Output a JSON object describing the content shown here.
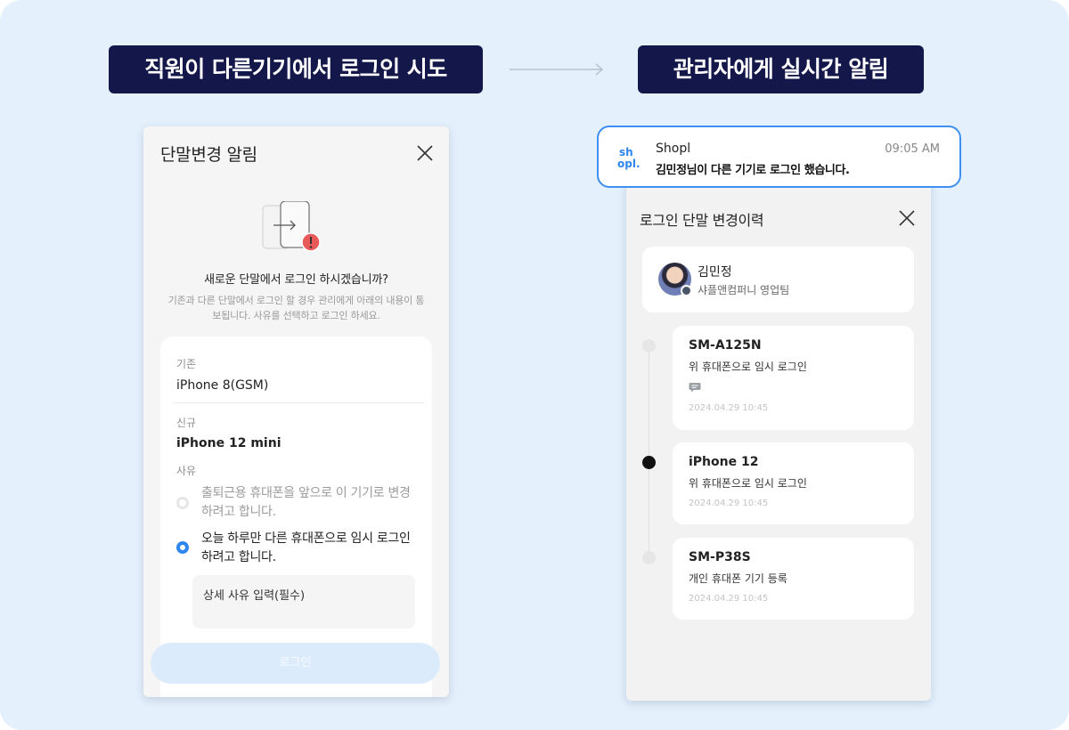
{
  "headline": {
    "left": "직원이 다른기기에서 로그인 시도",
    "right": "관리자에게 실시간 알림"
  },
  "device_change_modal": {
    "title": "단말변경 알림",
    "question": "새로운 단말에서 로그인 하시겠습니까?",
    "description": "기존과 다른 단말에서 로그인 할 경우 관리에게 아래의 내용이 통보됩니다. 사유를 선택하고 로그인 하세요.",
    "existing_label": "기존",
    "existing_value": "iPhone 8(GSM)",
    "new_label": "신규",
    "new_value": "iPhone 12 mini",
    "reason_label": "사유",
    "reason_options": [
      {
        "text": "출퇴근용 휴대폰을 앞으로 이 기기로 변경하려고 합니다.",
        "selected": false
      },
      {
        "text": "오늘 하루만 다른 휴대폰으로 임시 로그인 하려고 합니다.",
        "selected": true
      }
    ],
    "reason_detail_placeholder": "상세 사유 입력(필수)",
    "login_button": "로그인"
  },
  "notification": {
    "app_name": "Shopl",
    "logo_text_top": "sh",
    "logo_text_bottom": "opl.",
    "time": "09:05 AM",
    "message": "김민정님이 다른 기기로 로그인 했습니다."
  },
  "history_modal": {
    "title": "로그인 단말 변경이력",
    "profile": {
      "name": "김민정",
      "team": "샤플앤컴퍼니 영업팀"
    },
    "entries": [
      {
        "model": "SM-A125N",
        "description": "위 휴대폰으로 임시 로그인",
        "has_memo": true,
        "date": "2024.04.29 10:45",
        "current": false
      },
      {
        "model": "iPhone 12",
        "description": "위 휴대폰으로 임시 로그인",
        "has_memo": false,
        "date": "2024.04.29 10:45",
        "current": true
      },
      {
        "model": "SM-P38S",
        "description": "개인 휴대폰 기기 등록",
        "has_memo": false,
        "date": "2024.04.29 10:45",
        "current": false
      }
    ]
  },
  "colors": {
    "background": "#e4f0fc",
    "pill": "#14174a",
    "accent": "#2f86f0",
    "warning": "#e85a5a",
    "brand_logo": "#2f86f0"
  },
  "icons": [
    "arrow-right-icon",
    "close-icon",
    "device-switch-icon",
    "warning-icon",
    "shopl-logo",
    "memo-icon",
    "avatar-badge-icon"
  ]
}
